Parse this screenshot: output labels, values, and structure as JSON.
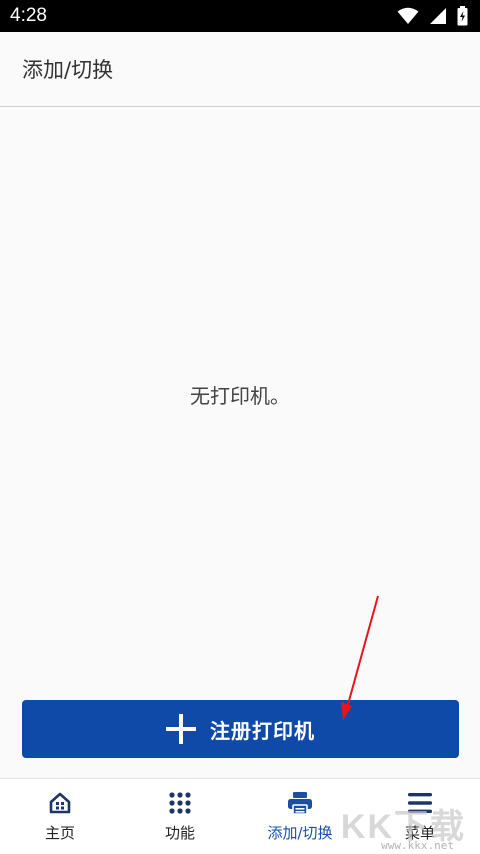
{
  "status_bar": {
    "time": "4:28",
    "icons": [
      "wifi-icon",
      "signal-icon",
      "battery-icon"
    ]
  },
  "header": {
    "title": "添加/切换"
  },
  "main": {
    "empty_message": "无打印机。",
    "register_button_label": "注册打印机",
    "register_button_icon": "plus-icon"
  },
  "bottom_nav": {
    "items": [
      {
        "label": "主页",
        "icon": "home-icon",
        "active": false
      },
      {
        "label": "功能",
        "icon": "grid-icon",
        "active": false
      },
      {
        "label": "添加/切换",
        "icon": "printer-icon",
        "active": true
      },
      {
        "label": "菜单",
        "icon": "menu-icon",
        "active": false
      }
    ]
  },
  "watermark": {
    "text": "KK下载",
    "url": "www.kkx.net"
  },
  "colors": {
    "primary": "#0f4aa8",
    "active_nav": "#1a4fa8",
    "nav_icon": "#1d3565",
    "annotation": "#e8141b"
  }
}
